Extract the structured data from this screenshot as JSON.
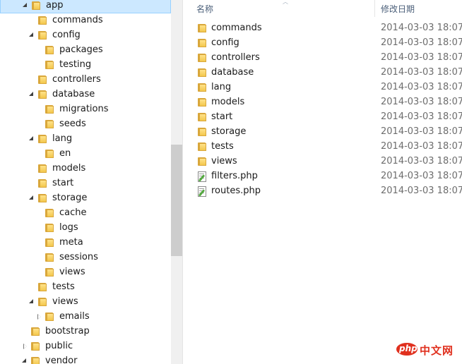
{
  "nav_tree": [
    {
      "label": "app",
      "level": 1,
      "expander": "open",
      "selected": true
    },
    {
      "label": "commands",
      "level": 2,
      "expander": "none"
    },
    {
      "label": "config",
      "level": 2,
      "expander": "open"
    },
    {
      "label": "packages",
      "level": 3,
      "expander": "none"
    },
    {
      "label": "testing",
      "level": 3,
      "expander": "none"
    },
    {
      "label": "controllers",
      "level": 2,
      "expander": "none"
    },
    {
      "label": "database",
      "level": 2,
      "expander": "open"
    },
    {
      "label": "migrations",
      "level": 3,
      "expander": "none"
    },
    {
      "label": "seeds",
      "level": 3,
      "expander": "none"
    },
    {
      "label": "lang",
      "level": 2,
      "expander": "open"
    },
    {
      "label": "en",
      "level": 3,
      "expander": "none"
    },
    {
      "label": "models",
      "level": 2,
      "expander": "none"
    },
    {
      "label": "start",
      "level": 2,
      "expander": "none"
    },
    {
      "label": "storage",
      "level": 2,
      "expander": "open"
    },
    {
      "label": "cache",
      "level": 3,
      "expander": "none"
    },
    {
      "label": "logs",
      "level": 3,
      "expander": "none"
    },
    {
      "label": "meta",
      "level": 3,
      "expander": "none"
    },
    {
      "label": "sessions",
      "level": 3,
      "expander": "none"
    },
    {
      "label": "views",
      "level": 3,
      "expander": "none"
    },
    {
      "label": "tests",
      "level": 2,
      "expander": "none"
    },
    {
      "label": "views",
      "level": 2,
      "expander": "open"
    },
    {
      "label": "emails",
      "level": 3,
      "expander": "closed"
    },
    {
      "label": "bootstrap",
      "level": 1,
      "expander": "none"
    },
    {
      "label": "public",
      "level": 1,
      "expander": "closed"
    },
    {
      "label": "vendor",
      "level": 1,
      "expander": "open"
    }
  ],
  "file_list": {
    "columns": {
      "name": "名称",
      "modified": "修改日期"
    },
    "rows": [
      {
        "name": "commands",
        "type": "folder",
        "modified": "2014-03-03 18:07"
      },
      {
        "name": "config",
        "type": "folder",
        "modified": "2014-03-03 18:07"
      },
      {
        "name": "controllers",
        "type": "folder",
        "modified": "2014-03-03 18:07"
      },
      {
        "name": "database",
        "type": "folder",
        "modified": "2014-03-03 18:07"
      },
      {
        "name": "lang",
        "type": "folder",
        "modified": "2014-03-03 18:07"
      },
      {
        "name": "models",
        "type": "folder",
        "modified": "2014-03-03 18:07"
      },
      {
        "name": "start",
        "type": "folder",
        "modified": "2014-03-03 18:07"
      },
      {
        "name": "storage",
        "type": "folder",
        "modified": "2014-03-03 18:07"
      },
      {
        "name": "tests",
        "type": "folder",
        "modified": "2014-03-03 18:07"
      },
      {
        "name": "views",
        "type": "folder",
        "modified": "2014-03-03 18:07"
      },
      {
        "name": "filters.php",
        "type": "php-file",
        "modified": "2014-03-03 18:07"
      },
      {
        "name": "routes.php",
        "type": "php-file",
        "modified": "2014-03-03 18:07"
      }
    ]
  },
  "watermark": {
    "logo": "php",
    "text": "中文网",
    "color": "#e0301e"
  },
  "colors": {
    "selection_bg": "#cce8ff",
    "selection_border": "#99d1ff",
    "header_text": "#4c607a",
    "folder": "#f3c74d"
  }
}
